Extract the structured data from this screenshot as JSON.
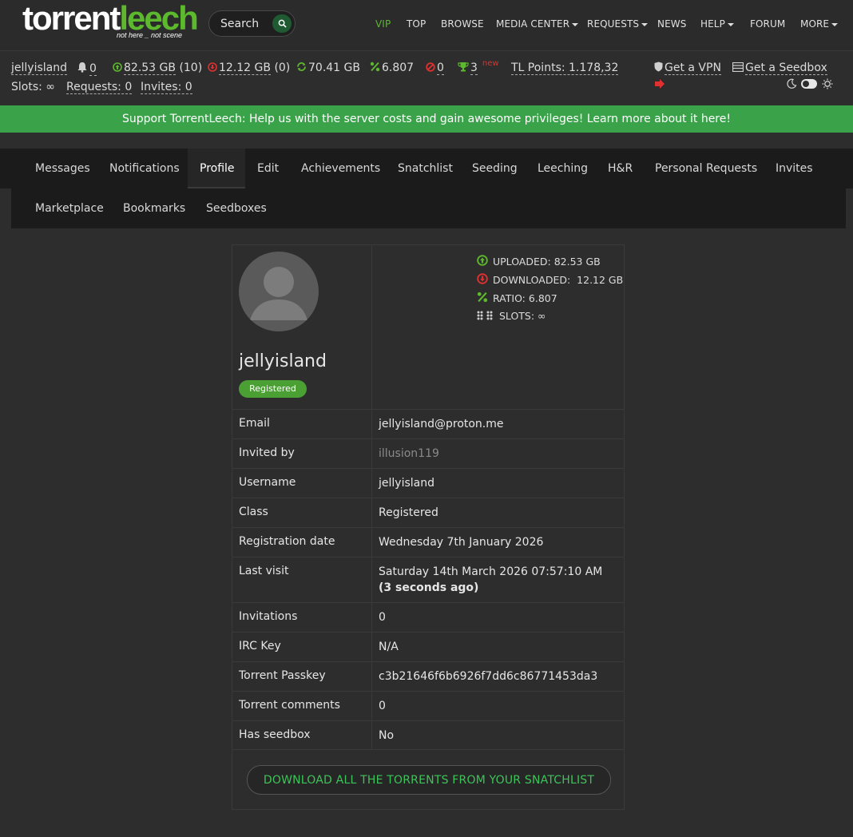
{
  "nav": {
    "logo_text_white": "torrent",
    "logo_text_green": "leech",
    "tagline_a": "not here _ not scene",
    "search_placeholder": "Search",
    "items": [
      "VIP",
      "TOP",
      "BROWSE",
      "MEDIA CENTER",
      "REQUESTS",
      "NEWS",
      "HELP",
      "FORUM",
      "MORE"
    ]
  },
  "stats": {
    "username": "jellyisland",
    "notifications": "0",
    "uploaded": "82.53 GB",
    "uploaded_count": "(10)",
    "downloaded": "12.12 GB",
    "downloaded_count": "(0)",
    "seedbonus": "70.41 GB",
    "ratio": "6.807",
    "hnr": "0",
    "achievements": "3",
    "achievements_new": "new",
    "tl_points": "TL Points: 1.178,32",
    "get_vpn": "Get a VPN",
    "get_seedbox": "Get a Seedbox",
    "slots_label": "Slots:",
    "slots_value": "∞",
    "requests": "Requests: 0",
    "invites": "Invites: 0"
  },
  "banner": {
    "text": "Support TorrentLeech: Help us with the server costs and gain awesome privileges! Learn more about it here!"
  },
  "tabs": {
    "row1": [
      "Messages",
      "Notifications",
      "Profile",
      "Edit",
      "Achievements",
      "Snatchlist",
      "Seeding",
      "Leeching",
      "H&R",
      "Personal Requests",
      "Invites"
    ],
    "row2": [
      "Marketplace",
      "Bookmarks",
      "Seedboxes"
    ],
    "active": "Profile"
  },
  "profile": {
    "username": "jellyisland",
    "class_badge": "Registered",
    "uploaded_label": "UPLOADED:",
    "uploaded_value": "82.53 GB",
    "downloaded_label": "DOWNLOADED:",
    "downloaded_value": "12.12 GB",
    "ratio_label": "RATIO:",
    "ratio_value": "6.807",
    "slots_label": "SLOTS:",
    "slots_value": "∞",
    "rows": [
      {
        "key": "Email",
        "value": "jellyisland@proton.me"
      },
      {
        "key": "Invited by",
        "value": "illusion119"
      },
      {
        "key": "Username",
        "value": "jellyisland"
      },
      {
        "key": "Class",
        "value": "Registered"
      },
      {
        "key": "Registration date",
        "value": "Wednesday 7th January 2026"
      },
      {
        "key": "Last visit",
        "value": "Saturday 14th March 2026 07:57:10 AM",
        "value_extra": "(3 seconds ago)"
      },
      {
        "key": "Invitations",
        "value": "0"
      },
      {
        "key": "IRC Key",
        "value": "N/A"
      },
      {
        "key": "Torrent Passkey",
        "value": "c3b21646f6b6926f7dd6c86771453da3"
      },
      {
        "key": "Torrent comments",
        "value": "0"
      },
      {
        "key": "Has seedbox",
        "value": "No"
      }
    ],
    "download_button": "DOWNLOAD ALL THE TORRENTS FROM YOUR SNATCHLIST"
  },
  "colors": {
    "accent_green": "#3aa34a",
    "up_green": "#5cb82c",
    "down_red": "#e03030"
  }
}
